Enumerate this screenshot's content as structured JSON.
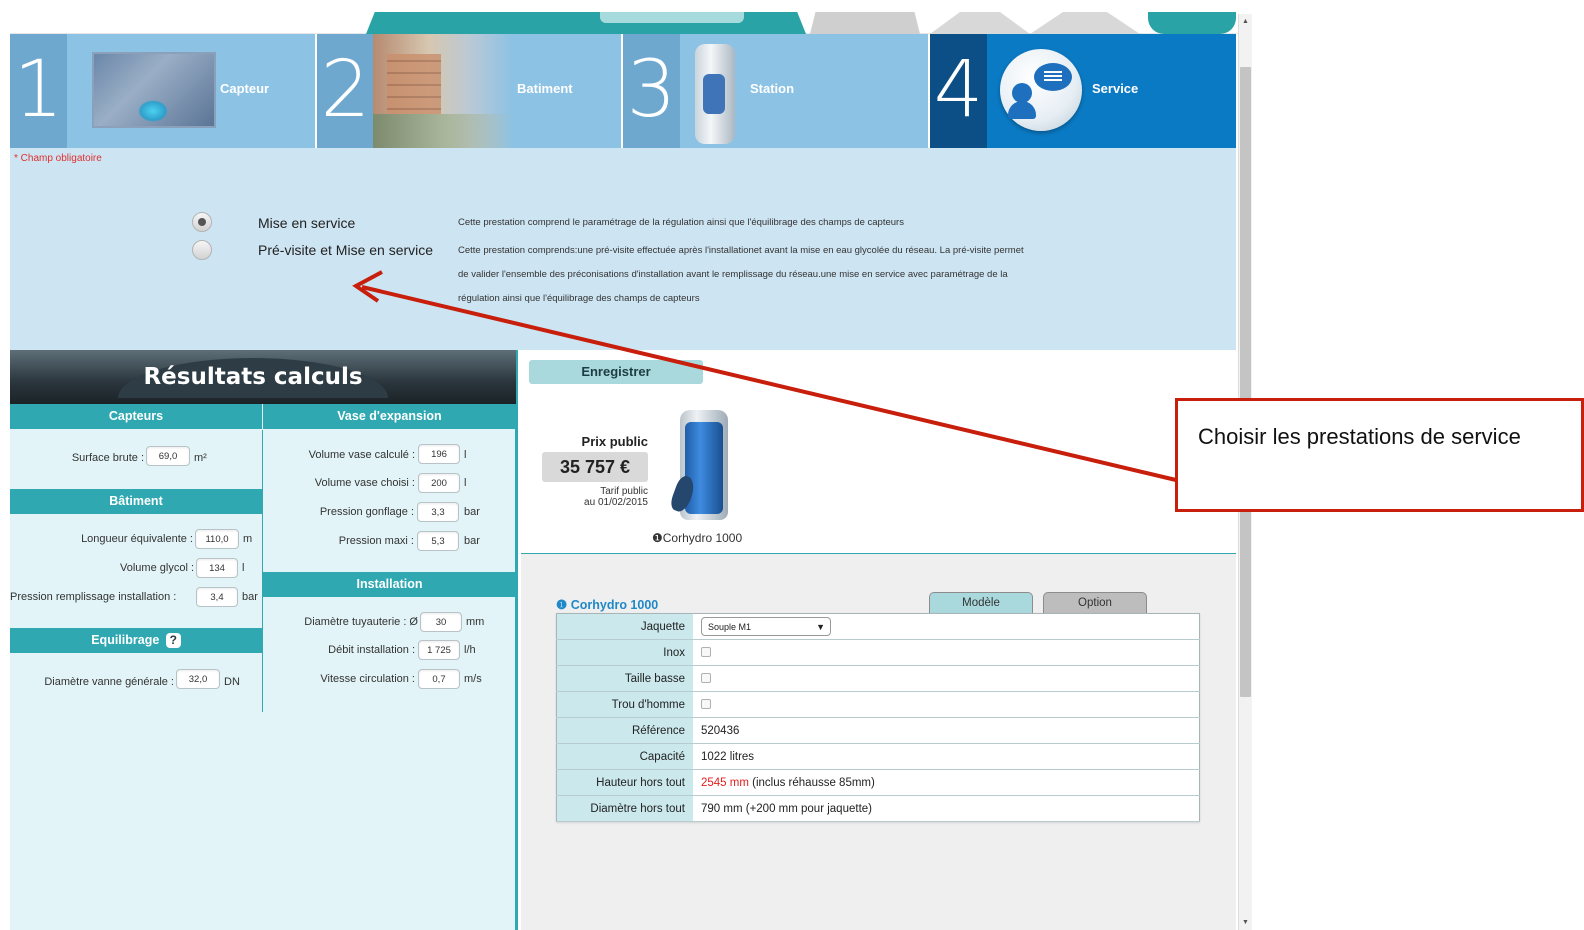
{
  "steps": [
    {
      "num": "1",
      "label": "Capteur"
    },
    {
      "num": "2",
      "label": "Batiment"
    },
    {
      "num": "3",
      "label": "Station"
    },
    {
      "num": "4",
      "label": "Service",
      "active": true
    }
  ],
  "required_note": "* Champ obligatoire",
  "service_options": [
    {
      "label": "Mise en service",
      "selected": true,
      "description": [
        "Cette prestation comprend le paramétrage de la régulation ainsi que l'équilibrage des champs de capteurs"
      ]
    },
    {
      "label": "Pré-visite et Mise en service",
      "selected": false,
      "description": [
        "Cette prestation comprends:une pré-visite effectuée après l'installationet avant la mise en eau glycolée du réseau. La pré-visite permet",
        "de valider l'ensemble des préconisations d'installation avant le remplissage du réseau.une mise en service avec paramétrage de la",
        "régulation ainsi que l'équilibrage des champs de capteurs"
      ]
    }
  ],
  "results": {
    "title": "Résultats calculs",
    "capteurs": {
      "heading": "Capteurs",
      "surface_label": "Surface brute :",
      "surface_value": "69,0",
      "surface_unit": "m²"
    },
    "batiment": {
      "heading": "Bâtiment",
      "rows": [
        {
          "label": "Longueur équivalente :",
          "value": "110,0",
          "unit": "m"
        },
        {
          "label": "Volume glycol :",
          "value": "134",
          "unit": "l"
        },
        {
          "label": "Pression remplissage installation :",
          "value": "3,4",
          "unit": "bar"
        }
      ]
    },
    "equilibrage": {
      "heading": "Equilibrage",
      "help": "?",
      "vanne_label": "Diamètre vanne générale :",
      "vanne_value": "32,0",
      "vanne_unit": "DN"
    },
    "vase": {
      "heading": "Vase d'expansion",
      "rows": [
        {
          "label": "Volume vase calculé :",
          "value": "196",
          "unit": "l"
        },
        {
          "label": "Volume vase choisi :",
          "value": "200",
          "unit": "l"
        },
        {
          "label": "Pression gonflage :",
          "value": "3,3",
          "unit": "bar"
        },
        {
          "label": "Pression maxi :",
          "value": "5,3",
          "unit": "bar"
        }
      ]
    },
    "installation": {
      "heading": "Installation",
      "rows": [
        {
          "label": "Diamètre tuyauterie : Ø",
          "value": "30",
          "unit": "mm"
        },
        {
          "label": "Débit installation :",
          "value": "1 725",
          "unit": "l/h"
        },
        {
          "label": "Vitesse circulation :",
          "value": "0,7",
          "unit": "m/s"
        }
      ]
    }
  },
  "product": {
    "save_label": "Enregistrer",
    "price_label": "Prix public",
    "price_value": "35 757 €",
    "price_note_1": "Tarif public",
    "price_note_2": "au 01/02/2015",
    "info_icon": "❶",
    "name": "Corhydro 1000",
    "section_title": "Corhydro 1000",
    "tabs": [
      "Modèle",
      "Option"
    ],
    "jaquette_label": "Jaquette",
    "jaquette_value": "Souple M1",
    "specs": [
      {
        "label": "Inox",
        "type": "checkbox"
      },
      {
        "label": "Taille basse",
        "type": "checkbox"
      },
      {
        "label": "Trou d'homme",
        "type": "checkbox"
      },
      {
        "label": "Référence",
        "value": "520436"
      },
      {
        "label": "Capacité",
        "value": "1022 litres"
      },
      {
        "label": "Hauteur hors tout",
        "value_highlight": "2545 mm",
        "value": " (inclus réhausse 85mm)"
      },
      {
        "label": "Diamètre hors tout",
        "value": "790 mm (+200 mm pour jaquette)"
      }
    ]
  },
  "callout": {
    "text": "Choisir les prestations de service"
  },
  "colors": {
    "teal": "#2fa8b2",
    "step_bg": "#8cc2e4",
    "step_active": "#0b7ac4",
    "callout_red": "#c81e0c",
    "highlight_red": "#e02020"
  }
}
